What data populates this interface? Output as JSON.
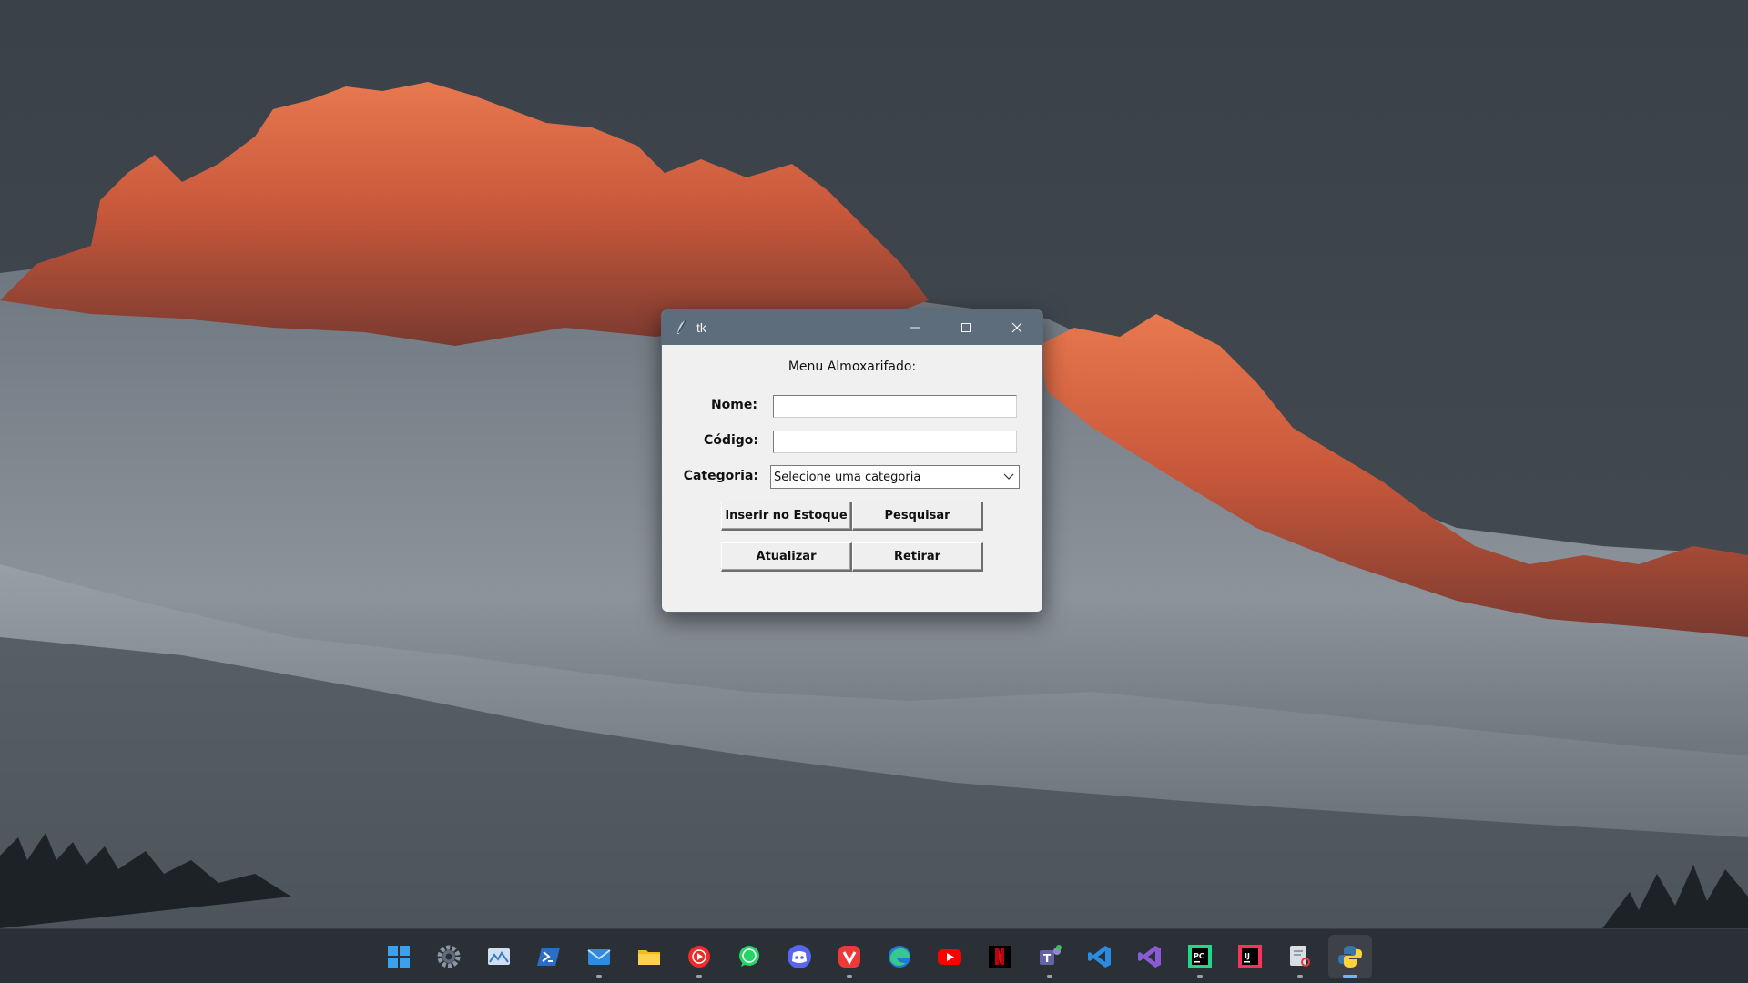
{
  "window": {
    "title": "tk",
    "heading": "Menu Almoxarifado:",
    "fields": {
      "nome": {
        "label": "Nome:",
        "value": ""
      },
      "codigo": {
        "label": "Código:",
        "value": ""
      },
      "categoria": {
        "label": "Categoria:",
        "selected": "Selecione uma categoria"
      }
    },
    "buttons": {
      "inserir": "Inserir no Estoque",
      "pesquisar": "Pesquisar",
      "atualizar": "Atualizar",
      "retirar": "Retirar"
    }
  },
  "taskbar": {
    "items": [
      {
        "icon": "windows-start-icon",
        "color": "#3aa0f0"
      },
      {
        "icon": "settings-gear-icon",
        "color": "#8c97a4"
      },
      {
        "icon": "image-viewer-icon",
        "color": "#9fc0e6"
      },
      {
        "icon": "powershell-icon",
        "color": "#2b6fc4"
      },
      {
        "icon": "mail-icon",
        "color": "#2f8ae0"
      },
      {
        "icon": "file-explorer-icon",
        "color": "#f2b81e"
      },
      {
        "icon": "youtube-music-icon",
        "color": "#ee2a2a"
      },
      {
        "icon": "whatsapp-icon",
        "color": "#25d366"
      },
      {
        "icon": "discord-icon",
        "color": "#5865f2"
      },
      {
        "icon": "vivaldi-icon",
        "color": "#ef3939"
      },
      {
        "icon": "edge-icon",
        "color": "#2fb3c6"
      },
      {
        "icon": "youtube-icon",
        "color": "#ff0000"
      },
      {
        "icon": "netflix-icon",
        "color": "#e50914"
      },
      {
        "icon": "teams-icon",
        "color": "#6264a7"
      },
      {
        "icon": "vscode-icon",
        "color": "#2a8ce0"
      },
      {
        "icon": "visual-studio-icon",
        "color": "#8a5bd6"
      },
      {
        "icon": "pycharm-icon",
        "color": "#21d789"
      },
      {
        "icon": "intellij-icon",
        "color": "#fe315d"
      },
      {
        "icon": "snipping-tool-icon",
        "color": "#d9dee5"
      },
      {
        "icon": "python-icon",
        "color": "#3776ab"
      }
    ]
  }
}
